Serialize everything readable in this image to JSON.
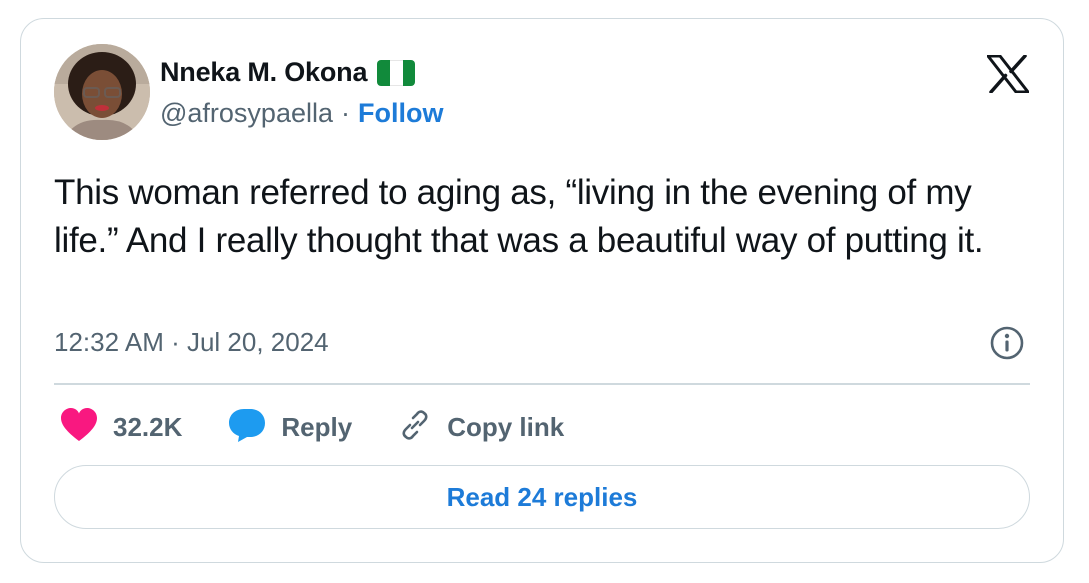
{
  "author": {
    "name": "Nneka M. Okona",
    "flag_icon": "nigeria-flag-icon",
    "flag_colors": [
      "#118a3b",
      "#ffffff",
      "#118a3b"
    ],
    "handle": "@afrosypaella",
    "separator": "·",
    "follow_label": "Follow"
  },
  "tweet": {
    "text": "This woman referred to aging as, “living in the evening of my life.” And I really thought that was a beautiful way of putting it.",
    "timestamp": "12:32 AM · Jul 20, 2024"
  },
  "actions": {
    "likes": {
      "icon": "heart-icon",
      "count": "32.2K",
      "color": "#f91880"
    },
    "reply": {
      "icon": "reply-bubble-icon",
      "label": "Reply",
      "color": "#1d9bf0"
    },
    "copy": {
      "icon": "link-icon",
      "label": "Copy link"
    }
  },
  "read_replies_label": "Read 24 replies",
  "colors": {
    "accent": "#1d7bd8",
    "muted": "#536471",
    "border": "#cfd9de"
  }
}
